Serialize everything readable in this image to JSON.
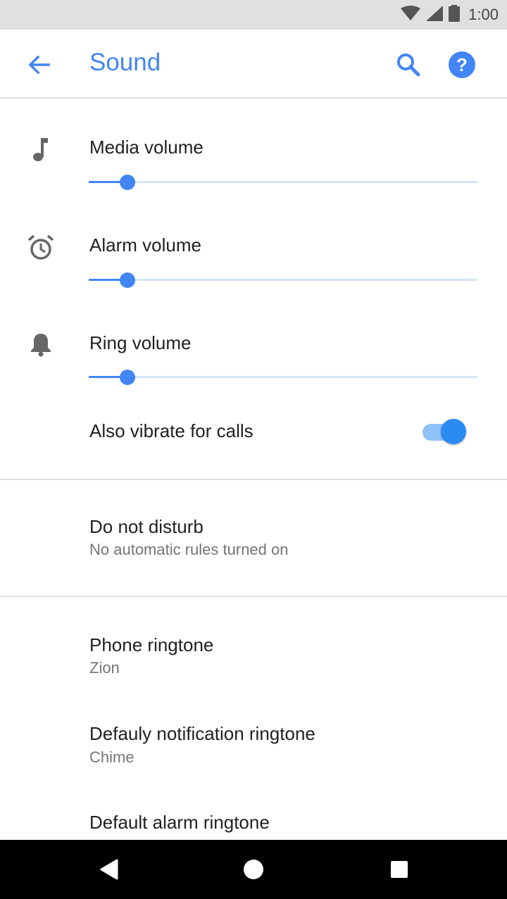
{
  "status_bar": {
    "time": "1:00",
    "icons": [
      "wifi-icon",
      "signal-icon",
      "battery-icon"
    ]
  },
  "app_bar": {
    "title": "Sound",
    "icons": [
      "back-arrow-icon",
      "search-icon",
      "help-icon"
    ]
  },
  "volumes": [
    {
      "label": "Media volume",
      "icon": "music-note-icon",
      "level": 0.1
    },
    {
      "label": "Alarm volume",
      "icon": "alarm-clock-icon",
      "level": 0.1
    },
    {
      "label": "Ring volume",
      "icon": "bell-icon",
      "level": 0.1
    }
  ],
  "vibrate": {
    "label": "Also vibrate for calls",
    "enabled": true
  },
  "do_not_disturb": {
    "label": "Do not disturb",
    "summary": "No automatic rules turned on"
  },
  "ringtones": [
    {
      "label": "Phone ringtone",
      "value": "Zion"
    },
    {
      "label": "Defauly notification ringtone",
      "value": "Chime"
    },
    {
      "label": "Default alarm ringtone"
    }
  ],
  "nav_bar": {
    "icons": [
      "back-triangle-icon",
      "home-circle-icon",
      "recents-square-icon"
    ]
  },
  "colors": {
    "accent": "#4285f4",
    "toggle_on": "#2a8bf2",
    "status_bar_bg": "#e0e0e0",
    "nav_bar_bg": "#000000"
  }
}
